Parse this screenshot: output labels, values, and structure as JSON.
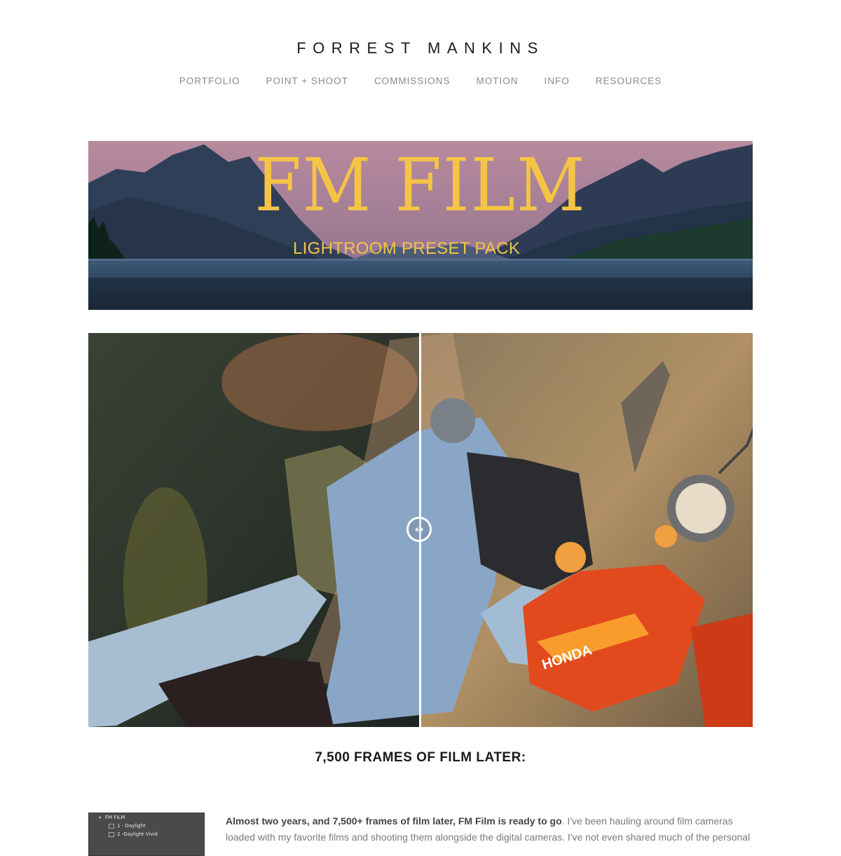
{
  "header": {
    "site_title": "FORREST MANKINS",
    "nav": [
      {
        "label": "PORTFOLIO"
      },
      {
        "label": "POINT + SHOOT"
      },
      {
        "label": "COMMISSIONS"
      },
      {
        "label": "MOTION"
      },
      {
        "label": "INFO"
      },
      {
        "label": "RESOURCES"
      }
    ]
  },
  "banner": {
    "title": "FM FILM",
    "subtitle": "LIGHTROOM PRESET PACK",
    "accent_color": "#f5c445"
  },
  "comparison": {
    "handle_icon": "left-right-arrows-icon",
    "split_fraction": 0.5,
    "motorcycle_brand_text": "HONDA"
  },
  "section": {
    "heading": "7,500 FRAMES OF FILM LATER:"
  },
  "lightroom_panel": {
    "folder": "FM FILM",
    "presets": [
      "1 - Daylight",
      "2 -Daylight Vivid"
    ]
  },
  "intro": {
    "lead_bold": "Almost two years, and 7,500+ frames of film later, FM Film is ready to go",
    "text": ". I've been hauling around film cameras loaded with my favorite films and shooting them alongside the digital cameras. I've not even shared much of the personal"
  }
}
